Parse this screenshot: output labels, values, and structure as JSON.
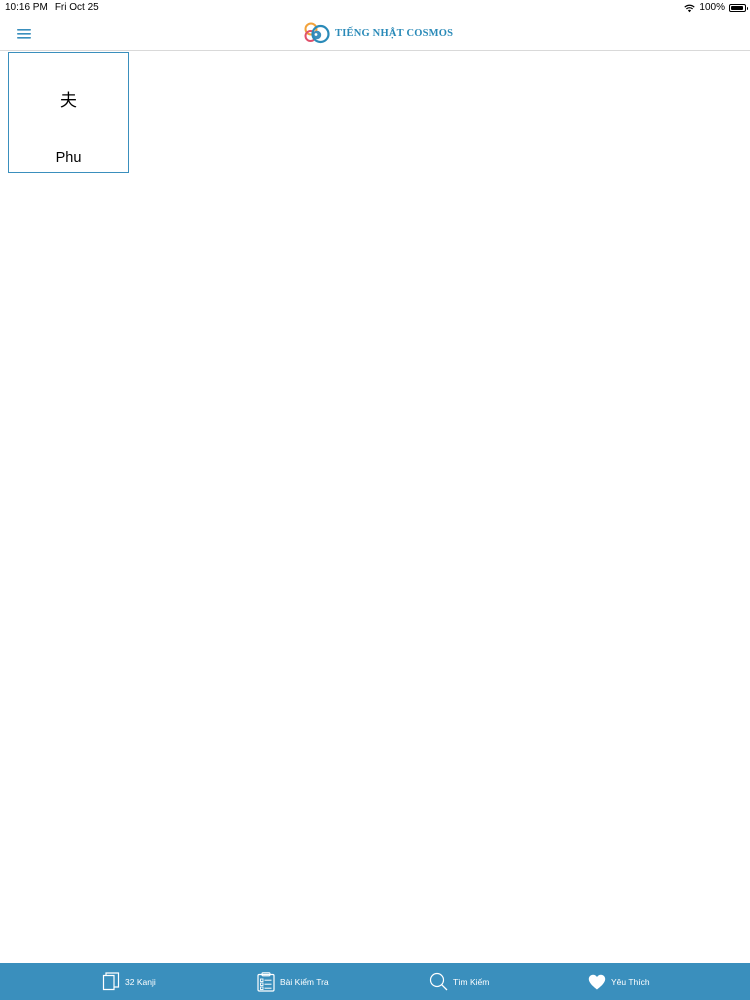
{
  "status_bar": {
    "time": "10:16 PM",
    "date": "Fri Oct 25",
    "battery": "100%"
  },
  "header": {
    "brand_title": "TIẾNG NHẬT COSMOS",
    "menu_icon": "hamburger-icon",
    "logo_icon": "cosmos-logo"
  },
  "kanji_list": [
    {
      "kanji": "夫",
      "reading": "Phu"
    }
  ],
  "tab_bar": {
    "tabs": [
      {
        "label": "32 Kanji",
        "icon": "document-icon"
      },
      {
        "label": "Bài Kiểm Tra",
        "icon": "clipboard-icon"
      },
      {
        "label": "Tìm Kiếm",
        "icon": "search-icon"
      },
      {
        "label": "Yêu Thích",
        "icon": "heart-icon"
      }
    ]
  },
  "colors": {
    "accent": "#3a8fbd",
    "brand_text": "#2a8ab8",
    "tab_text": "#ffffff"
  }
}
